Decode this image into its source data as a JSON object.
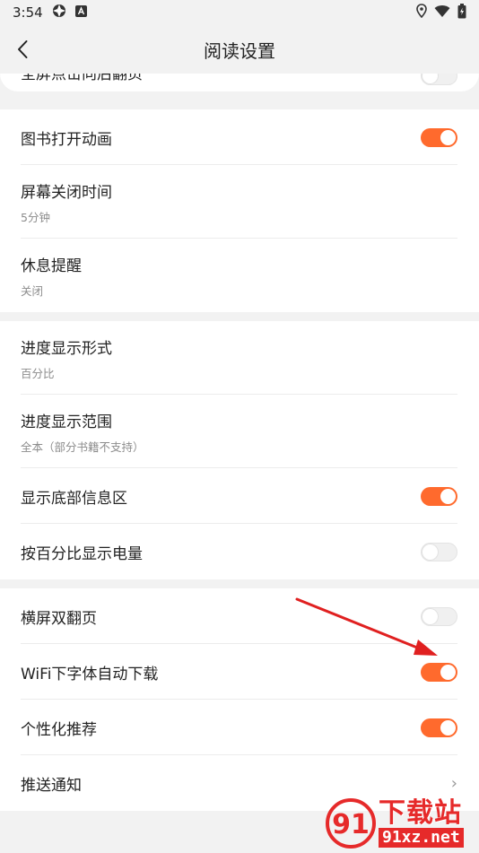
{
  "status_bar": {
    "time": "3:54"
  },
  "header": {
    "title": "阅读设置"
  },
  "partial_row": {
    "label": "全屏点击向后翻页",
    "on": false
  },
  "groups": [
    {
      "rows": [
        {
          "label": "图书打开动画",
          "type": "toggle",
          "on": true
        },
        {
          "label": "屏幕关闭时间",
          "sub": "5分钟",
          "type": "value"
        },
        {
          "label": "休息提醒",
          "sub": "关闭",
          "type": "value"
        }
      ]
    },
    {
      "rows": [
        {
          "label": "进度显示形式",
          "sub": "百分比",
          "type": "value"
        },
        {
          "label": "进度显示范围",
          "sub": "全本（部分书籍不支持）",
          "type": "value"
        },
        {
          "label": "显示底部信息区",
          "type": "toggle",
          "on": true
        },
        {
          "label": "按百分比显示电量",
          "type": "toggle",
          "on": false
        }
      ]
    },
    {
      "rows": [
        {
          "label": "横屏双翻页",
          "type": "toggle",
          "on": false
        },
        {
          "label": "WiFi下字体自动下载",
          "type": "toggle",
          "on": true
        },
        {
          "label": "个性化推荐",
          "type": "toggle",
          "on": true
        },
        {
          "label": "推送通知",
          "type": "chevron"
        }
      ]
    }
  ],
  "watermark": {
    "brand": "下载站",
    "domain": "91xz.net"
  },
  "colors": {
    "accent": "#ff6a2d",
    "background": "#f2f2f2",
    "annotation_arrow": "#e02020"
  }
}
